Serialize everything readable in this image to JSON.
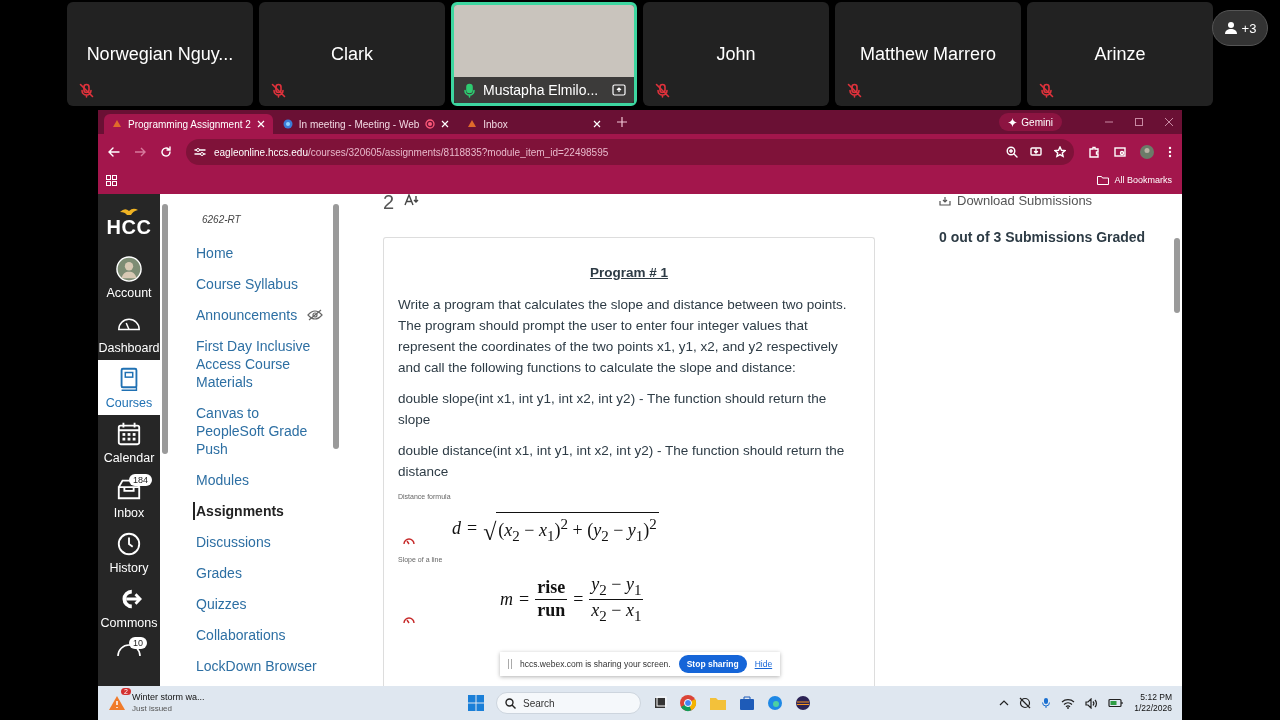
{
  "meeting": {
    "participants": [
      {
        "name": "Norwegian Nguy...",
        "muted": true,
        "video": false,
        "speaking": false,
        "sharing": false
      },
      {
        "name": "Clark",
        "muted": true,
        "video": false,
        "speaking": false,
        "sharing": false
      },
      {
        "name": "Mustapha Elmilo...",
        "muted": false,
        "video": true,
        "speaking": true,
        "sharing": true
      },
      {
        "name": "John",
        "muted": true,
        "video": false,
        "speaking": false,
        "sharing": false
      },
      {
        "name": "Matthew Marrero",
        "muted": true,
        "video": false,
        "speaking": false,
        "sharing": false
      },
      {
        "name": "Arinze",
        "muted": true,
        "video": false,
        "speaking": false,
        "sharing": false
      }
    ],
    "overflow_count": "+3"
  },
  "browser": {
    "tabs": [
      {
        "title": "Programming Assignment 2",
        "selected": true,
        "recording": false
      },
      {
        "title": "In meeting - Meeting - Web",
        "selected": false,
        "recording": true
      },
      {
        "title": "Inbox",
        "selected": false,
        "recording": false
      }
    ],
    "gemini": "Gemini",
    "url_host": "eagleonline.hccs.edu",
    "url_path": "/courses/320605/assignments/8118835?module_item_id=22498595",
    "bookmarks": "All Bookmarks"
  },
  "global_nav": {
    "logo": "HCC",
    "items": [
      {
        "label": "Account",
        "kind": "avatar",
        "selected": false
      },
      {
        "label": "Dashboard",
        "kind": "dashboard",
        "selected": false
      },
      {
        "label": "Courses",
        "kind": "courses",
        "selected": true
      },
      {
        "label": "Calendar",
        "kind": "calendar",
        "selected": false
      },
      {
        "label": "Inbox",
        "kind": "inbox",
        "selected": false,
        "badge": "184"
      },
      {
        "label": "History",
        "kind": "history",
        "selected": false
      },
      {
        "label": "Commons",
        "kind": "commons",
        "selected": false
      }
    ],
    "partial_badge": "10"
  },
  "course_nav": {
    "course_code": "6262-RT",
    "items": [
      {
        "label": "Home",
        "selected": false,
        "hidden": false
      },
      {
        "label": "Course Syllabus",
        "selected": false,
        "hidden": false
      },
      {
        "label": "Announcements",
        "selected": false,
        "hidden": true
      },
      {
        "label": "First Day Inclusive Access Course Materials",
        "selected": false,
        "hidden": false
      },
      {
        "label": "Canvas to PeopleSoft Grade Push",
        "selected": false,
        "hidden": false
      },
      {
        "label": "Modules",
        "selected": false,
        "hidden": false
      },
      {
        "label": "Assignments",
        "selected": true,
        "hidden": false
      },
      {
        "label": "Discussions",
        "selected": false,
        "hidden": false
      },
      {
        "label": "Grades",
        "selected": false,
        "hidden": false
      },
      {
        "label": "Quizzes",
        "selected": false,
        "hidden": false
      },
      {
        "label": "Collaborations",
        "selected": false,
        "hidden": false
      },
      {
        "label": "LockDown Browser",
        "selected": false,
        "hidden": false
      }
    ]
  },
  "assignment": {
    "points": "2",
    "download": "Download Submissions",
    "graded": "**0** out of **3 Submissions Graded**",
    "title": "Program # 1",
    "paragraphs": [
      "Write a program that calculates the slope and distance between two points. The program should prompt the user to enter four integer values that represent the coordinates of the two points x1, y1, x2, and y2 respectively and call the following functions to calculate the slope and distance:",
      "double slope(int x1, int y1, int x2, int y2) - The function should return the slope",
      "double distance(int x1, int y1, int x2, int y2) - The function should return the distance"
    ],
    "formulas": [
      {
        "kind": "root",
        "label": "Distance formula",
        "lhs": "d",
        "relation": "=",
        "radical": "√",
        "radicand": "(*x*$_{2}$ − *x*$_{1}$)$^{2}$ + (*y*$_{2}$ − *y*$_{1}$)$^{2}$"
      },
      {
        "kind": "fraction",
        "label": "Slope of a line",
        "lhs": "m",
        "relation": "=",
        "fractions": [
          {
            "numerator": "rise",
            "denominator": "run"
          },
          {
            "numerator": "*y*$_{2}$ − *y*$_{1}$",
            "denominator": "*x*$_{2}$ − *x*$_{1}$"
          }
        ]
      }
    ]
  },
  "share_bar": {
    "message": "hccs.webex.com is sharing your screen.",
    "stop": "Stop sharing",
    "hide": "Hide"
  },
  "taskbar": {
    "weather": {
      "badge": "2",
      "title": "Winter storm wa...",
      "subtitle": "Just issued"
    },
    "search": {
      "placeholder": "Search"
    },
    "time": "5:12 PM",
    "date": "1/22/2026"
  }
}
